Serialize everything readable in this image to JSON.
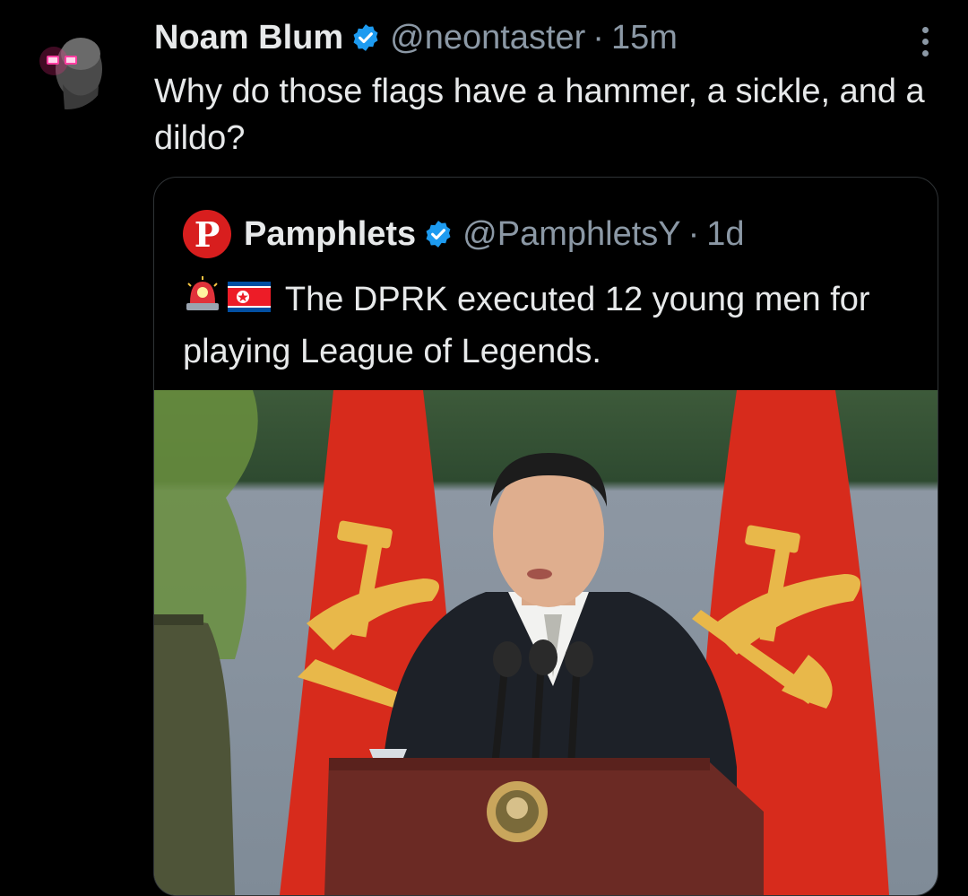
{
  "tweet": {
    "author_name": "Noam Blum",
    "handle": "@neontaster",
    "separator": "·",
    "time": "15m",
    "text": "Why do those flags have a hammer, a sickle, and a dildo?"
  },
  "quoted": {
    "author_name": "Pamphlets",
    "logo_letter": "P",
    "handle": "@PamphletsY",
    "separator": "·",
    "time": "1d",
    "text": "The DPRK executed 12 young men for playing League of Legends.",
    "emojis": [
      "police-light-icon",
      "north-korea-flag-icon"
    ],
    "photo_description": "Leader speaking at podium with microphones in front of two red party flags"
  },
  "colors": {
    "background": "#000000",
    "text_primary": "#e7e9ea",
    "text_secondary": "#8b98a5",
    "verified_blue": "#1d9bf0",
    "logo_red": "#d81e1e",
    "border": "#2f3336"
  }
}
